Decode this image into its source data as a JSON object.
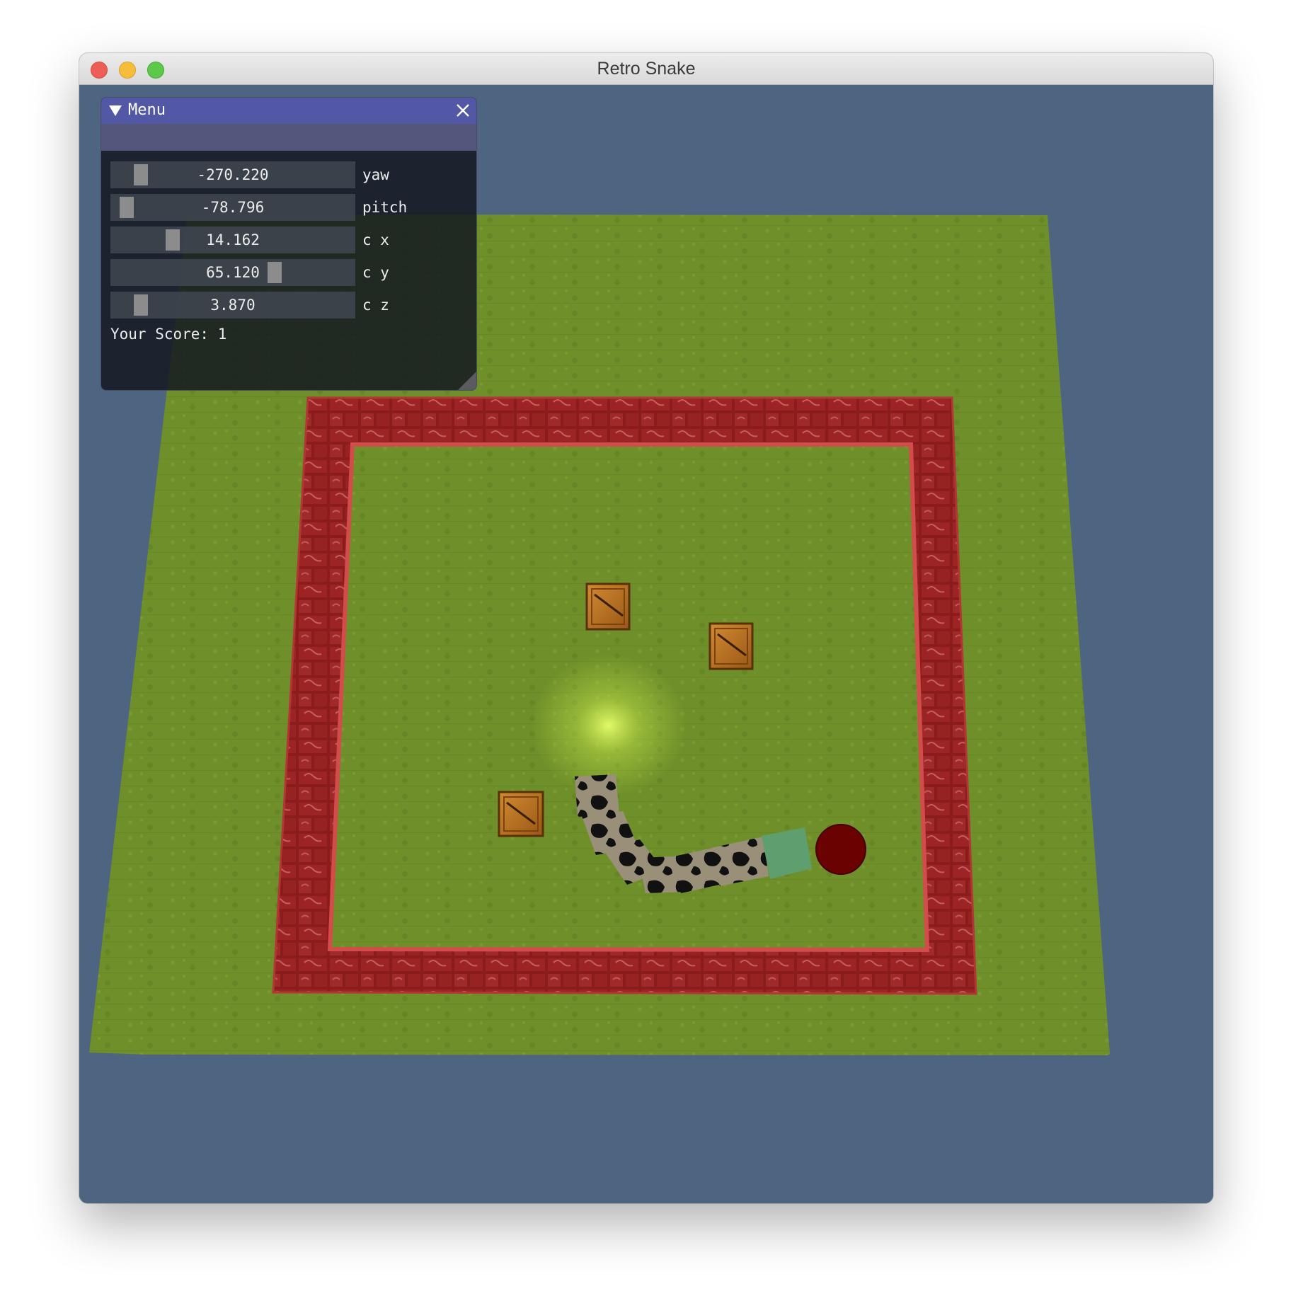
{
  "window": {
    "title": "Retro Snake"
  },
  "menu": {
    "title": "Menu",
    "sliders": [
      {
        "name": "yaw",
        "value": "-270.220",
        "label": "yaw",
        "level": 0.1
      },
      {
        "name": "pitch",
        "value": "-78.796",
        "label": "pitch",
        "level": 0.04
      },
      {
        "name": "cx",
        "value": "14.162",
        "label": "c x",
        "level": 0.24
      },
      {
        "name": "cy",
        "value": "65.120",
        "label": "c y",
        "level": 0.68
      },
      {
        "name": "cz",
        "value": "3.870",
        "label": "c z",
        "level": 0.1
      }
    ],
    "score_text": "Your Score: 1"
  },
  "scene": {
    "crates": 3,
    "snake_segments": 7,
    "colors": {
      "background": "#4d6580",
      "grass": "#6f8f2a",
      "wall": "#8a1c1c",
      "crate": "#b8701e",
      "snake_head": "#5f9e6e",
      "food": "#6b0202",
      "menu_title": "#5257a6"
    },
    "icons": [
      "collapse-arrow-icon",
      "close-icon"
    ]
  }
}
